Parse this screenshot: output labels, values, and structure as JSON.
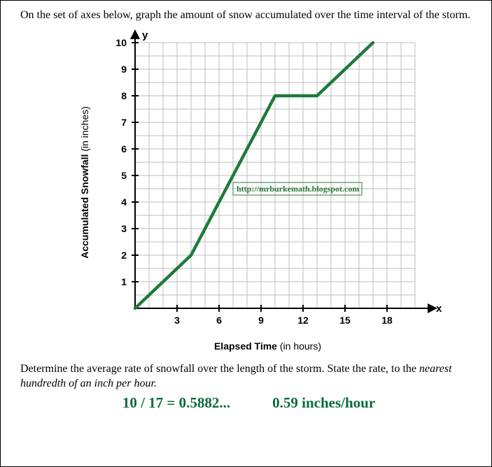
{
  "prompt": "On the set of axes below, graph the amount of snow accumulated over the time interval of the storm.",
  "chart_data": {
    "type": "line",
    "title": "",
    "xlabel_bold": "Elapsed Time",
    "xlabel_rest": " (in hours)",
    "ylabel_bold": "Accumulated Snowfall",
    "ylabel_rest": " (in inches)",
    "x_axis_letter": "x",
    "y_axis_letter": "y",
    "xlim": [
      0,
      20
    ],
    "ylim": [
      0,
      10.5
    ],
    "x_ticks": [
      3,
      6,
      9,
      12,
      15,
      18
    ],
    "y_ticks": [
      1,
      2,
      3,
      4,
      5,
      6,
      7,
      8,
      9,
      10
    ],
    "series": [
      {
        "name": "Accumulated Snowfall",
        "color": "#1f7a3a",
        "points": [
          {
            "x": 0,
            "y": 0
          },
          {
            "x": 4,
            "y": 2
          },
          {
            "x": 10,
            "y": 8
          },
          {
            "x": 13,
            "y": 8
          },
          {
            "x": 17,
            "y": 10
          }
        ]
      }
    ],
    "watermark": "http://mrburkemath.blogspot.com"
  },
  "question2_plain_a": "Determine the average rate of snowfall over the length of the storm. State the rate, to the ",
  "question2_italic": "nearest hundredth of an inch per hour.",
  "answer_calc": "10 / 17 = 0.5882...",
  "answer_value": "0.59 inches/hour"
}
